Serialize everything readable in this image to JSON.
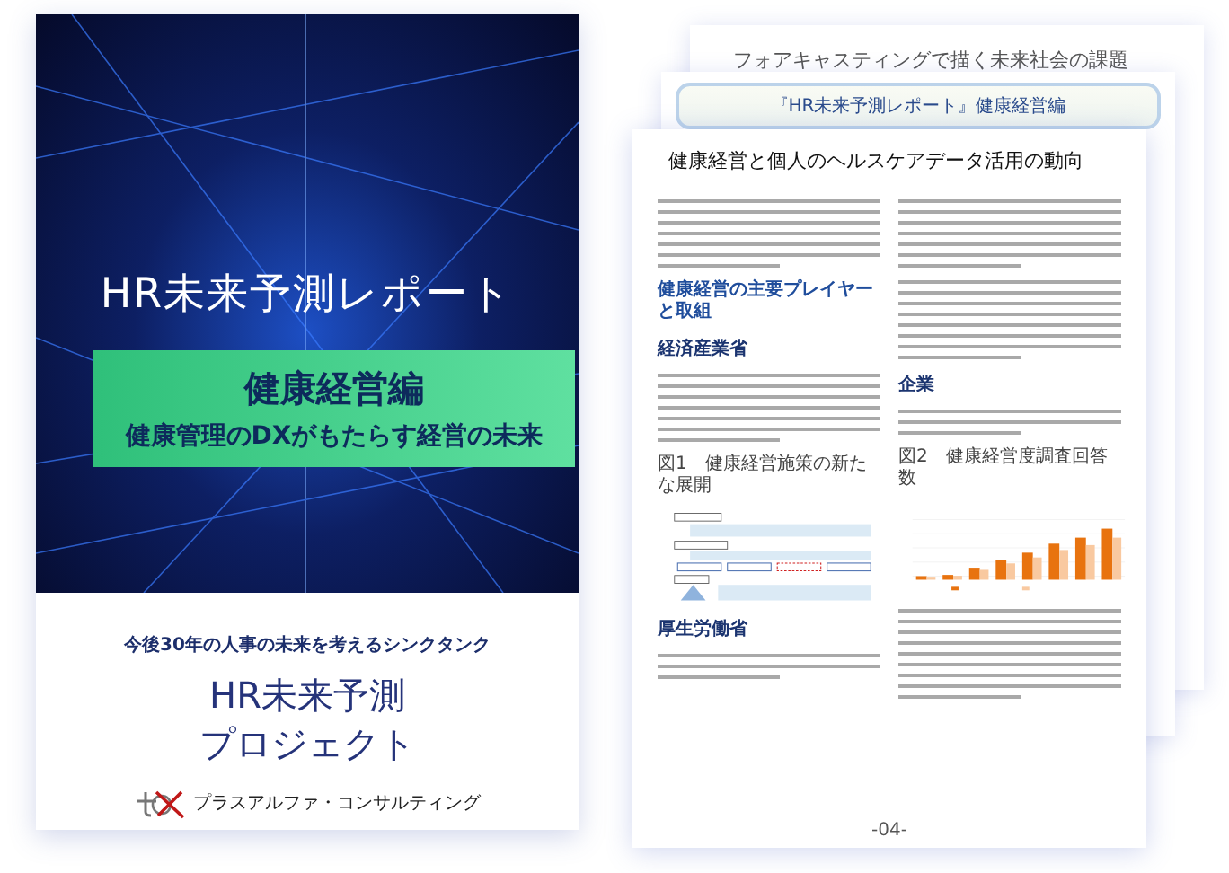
{
  "cover": {
    "title": "HR未来予測レポート",
    "band_title": "健康経営編",
    "band_subtitle": "健康管理のDXがもたらす経営の未来",
    "tagline": "今後30年の人事の未来を考えるシンクタンク",
    "project_lines": [
      "HR未来予測",
      "プロジェクト"
    ],
    "company": "プラスアルファ・コンサルティング"
  },
  "back_pages": [
    {
      "kind": "plain",
      "title": "フォアキャスティングで描く未来社会の課題"
    },
    {
      "kind": "framed",
      "title": "『HR未来予測レポート』健康経営編"
    }
  ],
  "front_page": {
    "title": "健康経営と個人のヘルスケアデータ活用の動向",
    "left_column": [
      {
        "kind": "paragraph"
      },
      {
        "kind": "heading",
        "text": "健康経営の主要プレイヤーと取組"
      },
      {
        "kind": "subheading",
        "text": "経済産業省"
      },
      {
        "kind": "paragraph"
      },
      {
        "kind": "figure",
        "text": "図1　健康経営施策の新たな展開"
      },
      {
        "kind": "subheading",
        "text": "厚生労働省"
      },
      {
        "kind": "short"
      }
    ],
    "right_column": [
      {
        "kind": "paragraph"
      },
      {
        "kind": "paragraph"
      },
      {
        "kind": "subheading",
        "text": "企業"
      },
      {
        "kind": "short"
      },
      {
        "kind": "chart",
        "text": "図2　健康経営度調査回答数"
      },
      {
        "kind": "paragraph"
      }
    ],
    "page_number": "-04-"
  }
}
